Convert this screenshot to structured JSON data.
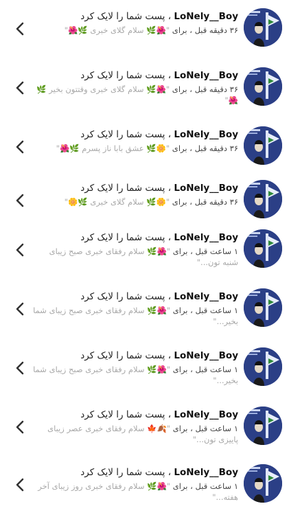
{
  "notifications": [
    {
      "username": "LoNely__Boy",
      "action": " ، پست شما را لایک کرد",
      "time": "۳۶ دقیقه قبل",
      "for_label": " ، برای ",
      "post": "\"🌺🌿 سلام گلای خبری 🌿🌺\""
    },
    {
      "username": "LoNely__Boy",
      "action": " ، پست شما را لایک کرد",
      "time": "۳۶ دقیقه قبل",
      "for_label": " ، برای ",
      "post": "\"🌺🌿 سلام گلای خبری وقتتون بخیر 🌿🌺\""
    },
    {
      "username": "LoNely__Boy",
      "action": " ، پست شما را لایک کرد",
      "time": "۳۶ دقیقه قبل",
      "for_label": " ، برای ",
      "post": "\"🌼🌿 عشق بابا ناز پسرم 🌿🌺\""
    },
    {
      "username": "LoNely__Boy",
      "action": " ، پست شما را لایک کرد",
      "time": "۳۶ دقیقه قبل",
      "for_label": " ، برای ",
      "post": "\"🌼🌿 سلام گلای خبری 🌿🌼\""
    },
    {
      "username": "LoNely__Boy",
      "action": " ، پست شما را لایک کرد",
      "time": "۱ ساعت قبل",
      "for_label": " ، برای ",
      "post": "\"🌺🌿 سلام رفقای خبری صبح زیبای شنبه تون...\""
    },
    {
      "username": "LoNely__Boy",
      "action": " ، پست شما را لایک کرد",
      "time": "۱ ساعت قبل",
      "for_label": " ، برای ",
      "post": "\"🌺🌿 سلام رفقای خبری صبح زیبای شما بخیر...\""
    },
    {
      "username": "LoNely__Boy",
      "action": " ، پست شما را لایک کرد",
      "time": "۱ ساعت قبل",
      "for_label": " ، برای ",
      "post": "\"🌺🌿 سلام رفقای خبری صبح زیبای شما بخیر...\""
    },
    {
      "username": "LoNely__Boy",
      "action": " ، پست شما را لایک کرد",
      "time": "۱ ساعت قبل",
      "for_label": " ، برای ",
      "post": "\"🍂🍁 سلام رفقای خبری عصر زیبای پاییزی تون...\""
    },
    {
      "username": "LoNely__Boy",
      "action": " ، پست شما را لایک کرد",
      "time": "۱ ساعت قبل",
      "for_label": " ، برای ",
      "post": "\"🌺🌿 سلام رفقای خبری روز زیبای آخر هفته...\""
    }
  ],
  "icons": {
    "chevron": "chevron-left-icon",
    "avatar": "profile-avatar"
  },
  "colors": {
    "text": "#222222",
    "muted": "#a8a8a8",
    "avatar_bg": "#2b3f86"
  }
}
